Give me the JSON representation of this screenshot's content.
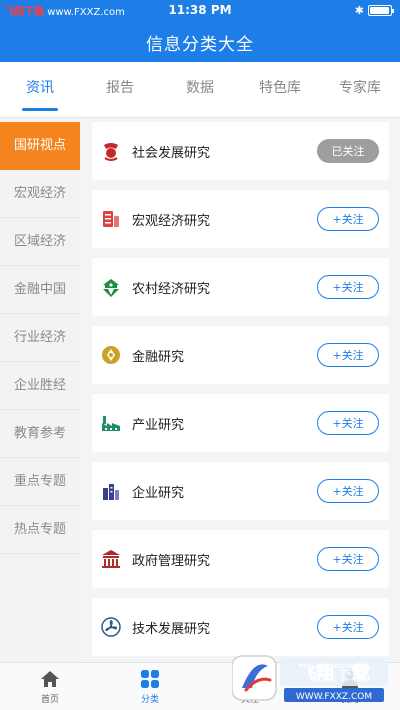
{
  "status_bar": {
    "site_name": "飞翔下载",
    "site_url": "www.FXXZ.com",
    "time": "11:38 PM",
    "battery_level": 0.95
  },
  "header": {
    "title": "信息分类大全"
  },
  "tabs": [
    {
      "label": "资讯",
      "active": true
    },
    {
      "label": "报告",
      "active": false
    },
    {
      "label": "数据",
      "active": false
    },
    {
      "label": "特色库",
      "active": false
    },
    {
      "label": "专家库",
      "active": false
    }
  ],
  "sidebar": {
    "items": [
      {
        "label": "国研视点",
        "active": true
      },
      {
        "label": "宏观经济",
        "active": false
      },
      {
        "label": "区域经济",
        "active": false
      },
      {
        "label": "金融中国",
        "active": false
      },
      {
        "label": "行业经济",
        "active": false
      },
      {
        "label": "企业胜经",
        "active": false
      },
      {
        "label": "教育参考",
        "active": false
      },
      {
        "label": "重点专题",
        "active": false
      },
      {
        "label": "热点专题",
        "active": false
      }
    ]
  },
  "categories": [
    {
      "label": "社会发展研究",
      "icon": "social-development-icon",
      "icon_color": "#c62828",
      "button": "已关注",
      "followed": true
    },
    {
      "label": "宏观经济研究",
      "icon": "macro-economy-icon",
      "icon_color": "#d84343",
      "button": "+关注",
      "followed": false
    },
    {
      "label": "农村经济研究",
      "icon": "rural-economy-icon",
      "icon_color": "#1e8e3e",
      "button": "+关注",
      "followed": false
    },
    {
      "label": "金融研究",
      "icon": "finance-coin-icon",
      "icon_color": "#c9a227",
      "button": "+关注",
      "followed": false
    },
    {
      "label": "产业研究",
      "icon": "industry-factory-icon",
      "icon_color": "#1e8e6e",
      "button": "+关注",
      "followed": false
    },
    {
      "label": "企业研究",
      "icon": "enterprise-building-icon",
      "icon_color": "#3b3f8f",
      "button": "+关注",
      "followed": false
    },
    {
      "label": "政府管理研究",
      "icon": "government-building-icon",
      "icon_color": "#b02a2a",
      "button": "+关注",
      "followed": false
    },
    {
      "label": "技术发展研究",
      "icon": "technology-fan-icon",
      "icon_color": "#2a5a8a",
      "button": "+关注",
      "followed": false
    }
  ],
  "bottom_nav": [
    {
      "label": "首页",
      "icon": "home-icon",
      "active": false
    },
    {
      "label": "分类",
      "icon": "grid-icon",
      "active": true
    },
    {
      "label": "关注",
      "icon": "follow-icon",
      "active": false
    },
    {
      "label": "我的",
      "icon": "profile-icon",
      "active": false
    }
  ],
  "watermark": {
    "text": "飞翔下载",
    "url": "WWW.FXXZ.COM"
  },
  "colors": {
    "primary": "#1d7ee8",
    "sidebar_active": "#f5841f",
    "followed_button": "#9e9e9e"
  }
}
